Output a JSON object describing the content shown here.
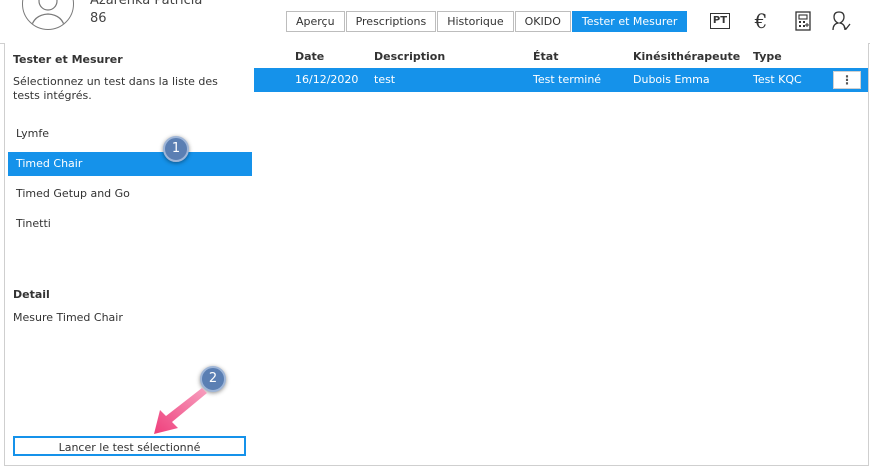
{
  "patient": {
    "name": "Azarenka Patricia",
    "number": "86"
  },
  "tabs": [
    {
      "label": "Aperçu",
      "active": false
    },
    {
      "label": "Prescriptions",
      "active": false
    },
    {
      "label": "Historique",
      "active": false
    },
    {
      "label": "OKIDO",
      "active": false
    },
    {
      "label": "Tester et Mesurer",
      "active": true
    }
  ],
  "header_icons": {
    "pt_label": "PT",
    "euro_symbol": "€",
    "icons": [
      "pt-badge-icon",
      "euro-icon",
      "calculator-icon",
      "person-check-icon"
    ]
  },
  "sidebar": {
    "title": "Tester et Mesurer",
    "description": "Sélectionnez un test dans la liste des tests intégrés.",
    "tests": [
      {
        "label": "Lymfe",
        "selected": false
      },
      {
        "label": "Timed Chair",
        "selected": true
      },
      {
        "label": "Timed Getup and Go",
        "selected": false
      },
      {
        "label": "Tinetti",
        "selected": false
      }
    ],
    "detail_title": "Detail",
    "detail_value": "Mesure Timed Chair",
    "launch_button": "Lancer le test sélectionné"
  },
  "table": {
    "columns": [
      "Date",
      "Description",
      "État",
      "Kinésithérapeute",
      "Type"
    ],
    "rows": [
      {
        "date": "16/12/2020",
        "description": "test",
        "state": "Test terminé",
        "therapist": "Dubois Emma",
        "type": "Test KQC"
      }
    ],
    "row_menu_symbol": "⋮"
  },
  "callouts": [
    "1",
    "2"
  ],
  "colors": {
    "accent": "#1592ea",
    "callout": "#5b7fb3",
    "arrow": "#f0457f"
  }
}
